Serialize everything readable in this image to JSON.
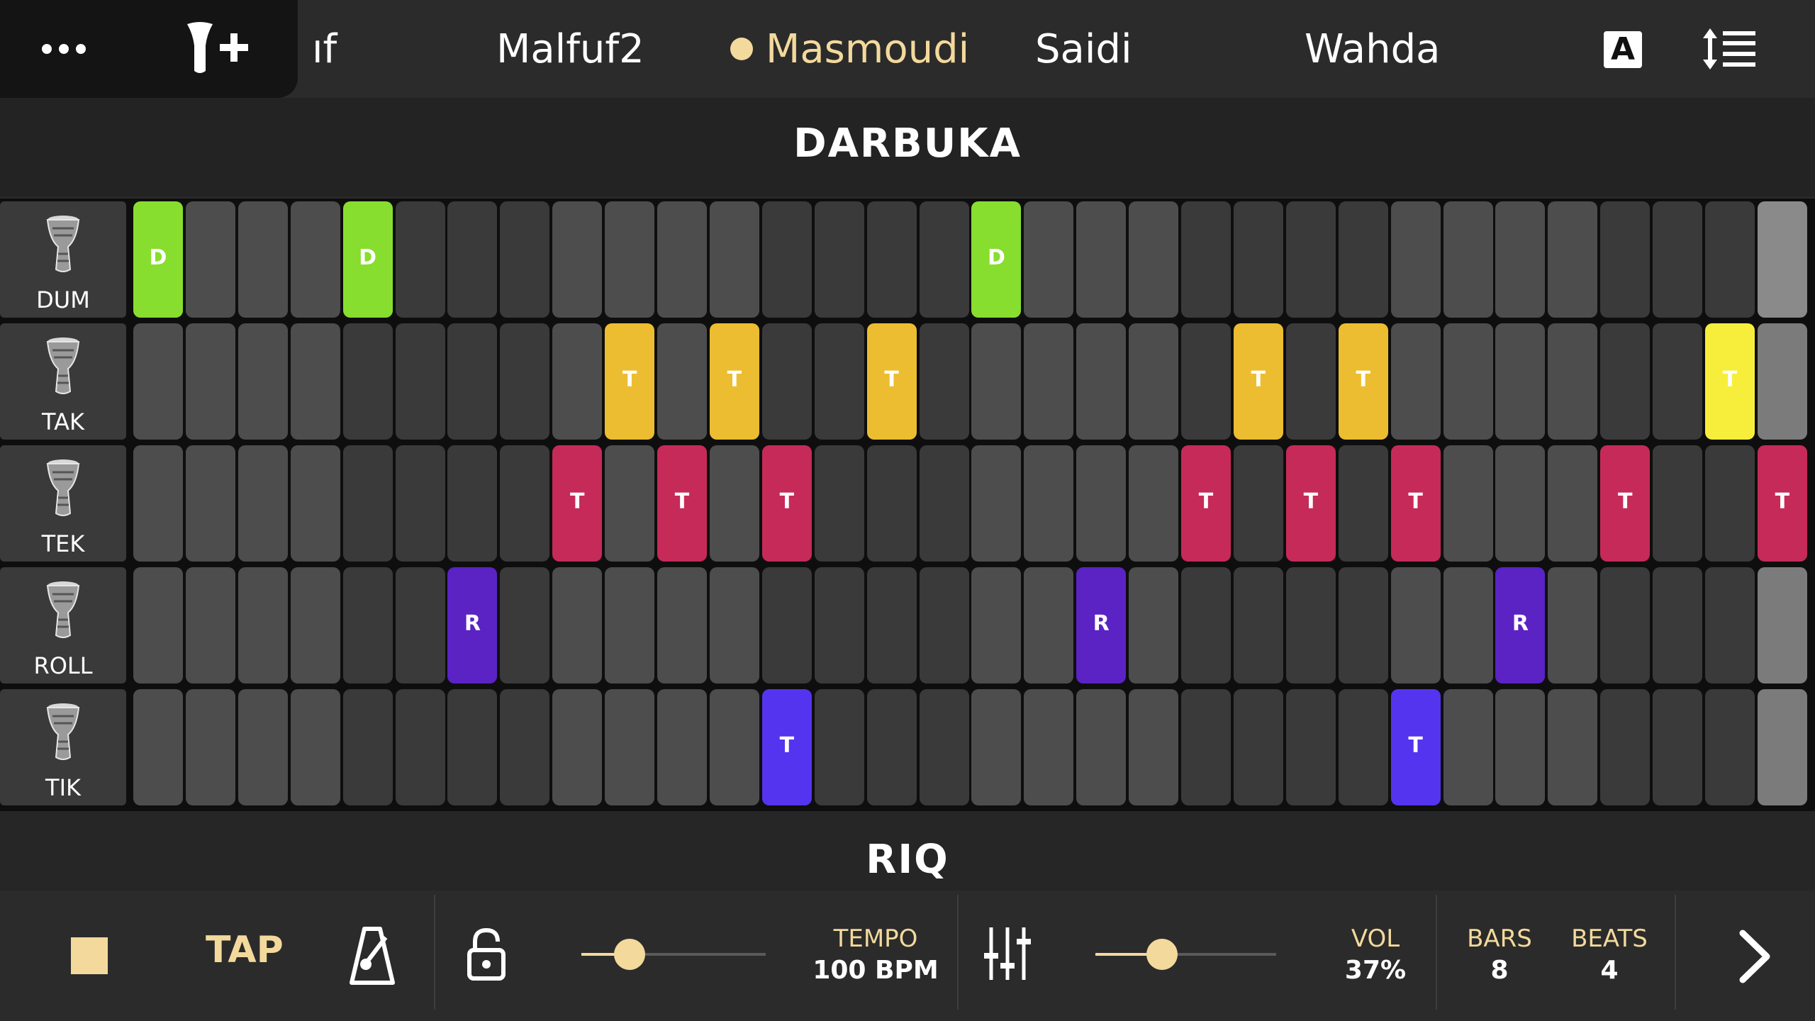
{
  "tabs": [
    {
      "label": "ıf"
    },
    {
      "label": "Malfuf2"
    },
    {
      "label": "Masmoudi",
      "active": true
    },
    {
      "label": "Saidi"
    },
    {
      "label": "Wahda"
    }
  ],
  "font_button": {
    "label": "A"
  },
  "sections": {
    "darbuka": "DARBUKA",
    "riq": "RIQ"
  },
  "instruments": [
    {
      "label": "DUM",
      "letter": "D",
      "color": "#87de2e",
      "steps": [
        0,
        4,
        16
      ],
      "alt": {
        "31": "#8a8a8a"
      }
    },
    {
      "label": "TAK",
      "letter": "T",
      "color": "#ecbd30",
      "steps": [
        9,
        11,
        14,
        21,
        23
      ],
      "alt": {
        "30": "#f7ee3b"
      }
    },
    {
      "label": "TEK",
      "letter": "T",
      "color": "#c62a58",
      "steps": [
        8,
        10,
        12,
        20,
        22,
        24,
        28,
        31
      ]
    },
    {
      "label": "ROLL",
      "letter": "R",
      "color": "#5b22c4",
      "steps": [
        6,
        18,
        26
      ]
    },
    {
      "label": "TIK",
      "letter": "T",
      "color": "#5434ee",
      "steps": [
        12,
        24
      ]
    }
  ],
  "toolbar": {
    "tap_label": "TAP",
    "tempo_label": "TEMPO",
    "tempo_value": "100 BPM",
    "tempo_level": 0.26,
    "vol_label": "VOL",
    "vol_value": "37%",
    "vol_level": 0.37,
    "bars_label": "BARS",
    "bars_value": "8",
    "beats_label": "BEATS",
    "beats_value": "4"
  },
  "colors": {
    "accent": "#f3d99c",
    "background": "#2b2b2b",
    "cell": "#4d4d4d",
    "cell_dark": "#3a3a3a",
    "playhead": "#7b7b7b"
  }
}
